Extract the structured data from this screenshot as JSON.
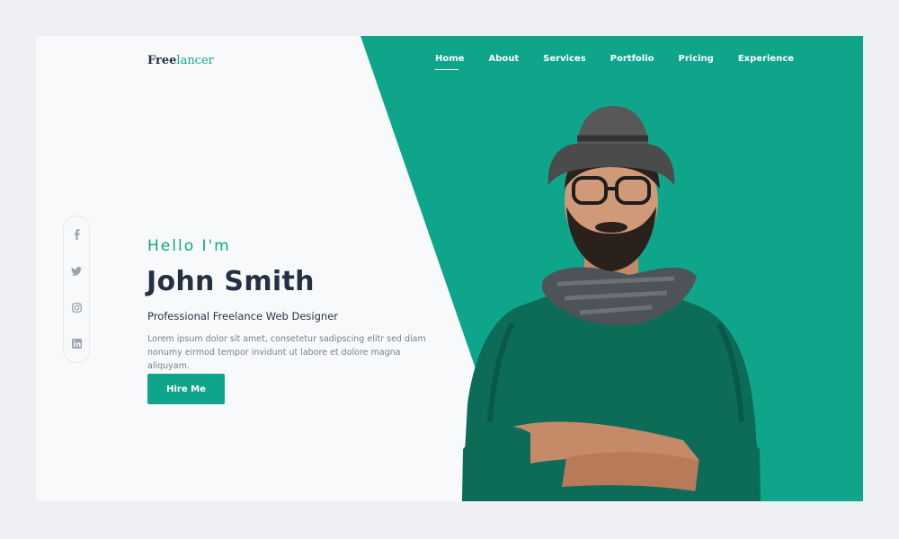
{
  "header": {
    "logo_main": "Free",
    "logo_accent": "lancer"
  },
  "nav": {
    "items": [
      {
        "label": "Home",
        "active": true
      },
      {
        "label": "About"
      },
      {
        "label": "Services"
      },
      {
        "label": "Portfolio"
      },
      {
        "label": "Pricing"
      },
      {
        "label": "Experience"
      }
    ]
  },
  "social": {
    "icons": [
      "facebook-icon",
      "twitter-icon",
      "instagram-icon",
      "linkedin-icon"
    ]
  },
  "hero": {
    "greeting": "Hello I'm",
    "name": "John Smith",
    "role": "Professional Freelance Web Designer",
    "description": "Lorem ipsum dolor sit amet, consetetur sadipscing elitr sed diam nonumy eirmod tempor invidunt ut labore et dolore magna aliquyam.",
    "cta_label": "Hire Me"
  },
  "colors": {
    "accent": "#0fa58a",
    "heading": "#253045",
    "background": "#f8f9fa"
  }
}
